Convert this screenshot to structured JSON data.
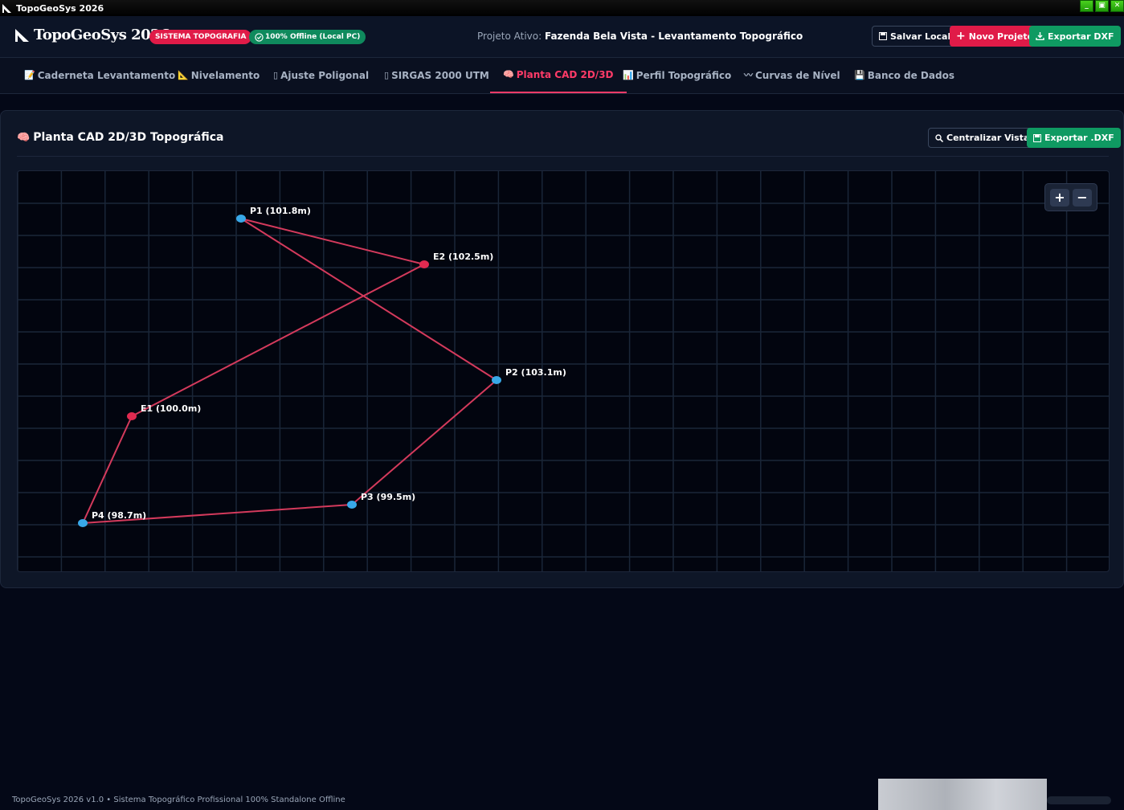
{
  "window": {
    "title": "TopoGeoSys 2026",
    "controls": [
      "_",
      "▣",
      "✕"
    ]
  },
  "header": {
    "logo_text": "TopoGeoSys 2026",
    "badge_system": "SISTEMA TOPOGRAFIA",
    "badge_offline": "100% Offline (Local PC)",
    "active_project_label": "Projeto Ativo:",
    "active_project_name": "Fazenda Bela Vista - Levantamento Topográfico",
    "buttons": {
      "save": "Salvar Local",
      "new": "Novo Projeto",
      "export": "Exportar DXF"
    }
  },
  "tabs": [
    {
      "label": "Caderneta Levantamento",
      "icon": "📝",
      "active": false
    },
    {
      "label": "Nivelamento",
      "icon": "📐",
      "active": false
    },
    {
      "label": "Ajuste Poligonal",
      "icon": "▯",
      "active": false
    },
    {
      "label": "SIRGAS 2000 UTM",
      "icon": "▯",
      "active": false
    },
    {
      "label": "Planta CAD 2D/3D",
      "icon": "🧠",
      "active": true
    },
    {
      "label": "Perfil Topográfico",
      "icon": "📊",
      "active": false
    },
    {
      "label": "Curvas de Nível",
      "icon": "〰",
      "active": false
    },
    {
      "label": "Banco de Dados",
      "icon": "💾",
      "active": false
    }
  ],
  "panel": {
    "title": "Planta CAD 2D/3D Topográfica",
    "btn_center": "Centralizar Vista",
    "btn_export": "Exportar .DXF",
    "zoom_in": "+",
    "zoom_out": "−"
  },
  "plot": {
    "points": [
      {
        "id": "P1",
        "label": "P1 (101.8m)",
        "type": "point"
      },
      {
        "id": "E2",
        "label": "E2 (102.5m)",
        "type": "station"
      },
      {
        "id": "P2",
        "label": "P2 (103.1m)",
        "type": "point"
      },
      {
        "id": "E1",
        "label": "E1 (100.0m)",
        "type": "station"
      },
      {
        "id": "P3",
        "label": "P3 (99.5m)",
        "type": "point"
      },
      {
        "id": "P4",
        "label": "P4 (98.7m)",
        "type": "point"
      }
    ],
    "colors": {
      "point": "#38a8e8",
      "station": "#e02a50",
      "line": "#d43a5c",
      "grid": "#1a2638"
    }
  },
  "footer": {
    "text": "TopoGeoSys 2026 v1.0 • Sistema Topográfico Profissional 100% Standalone Offline"
  }
}
